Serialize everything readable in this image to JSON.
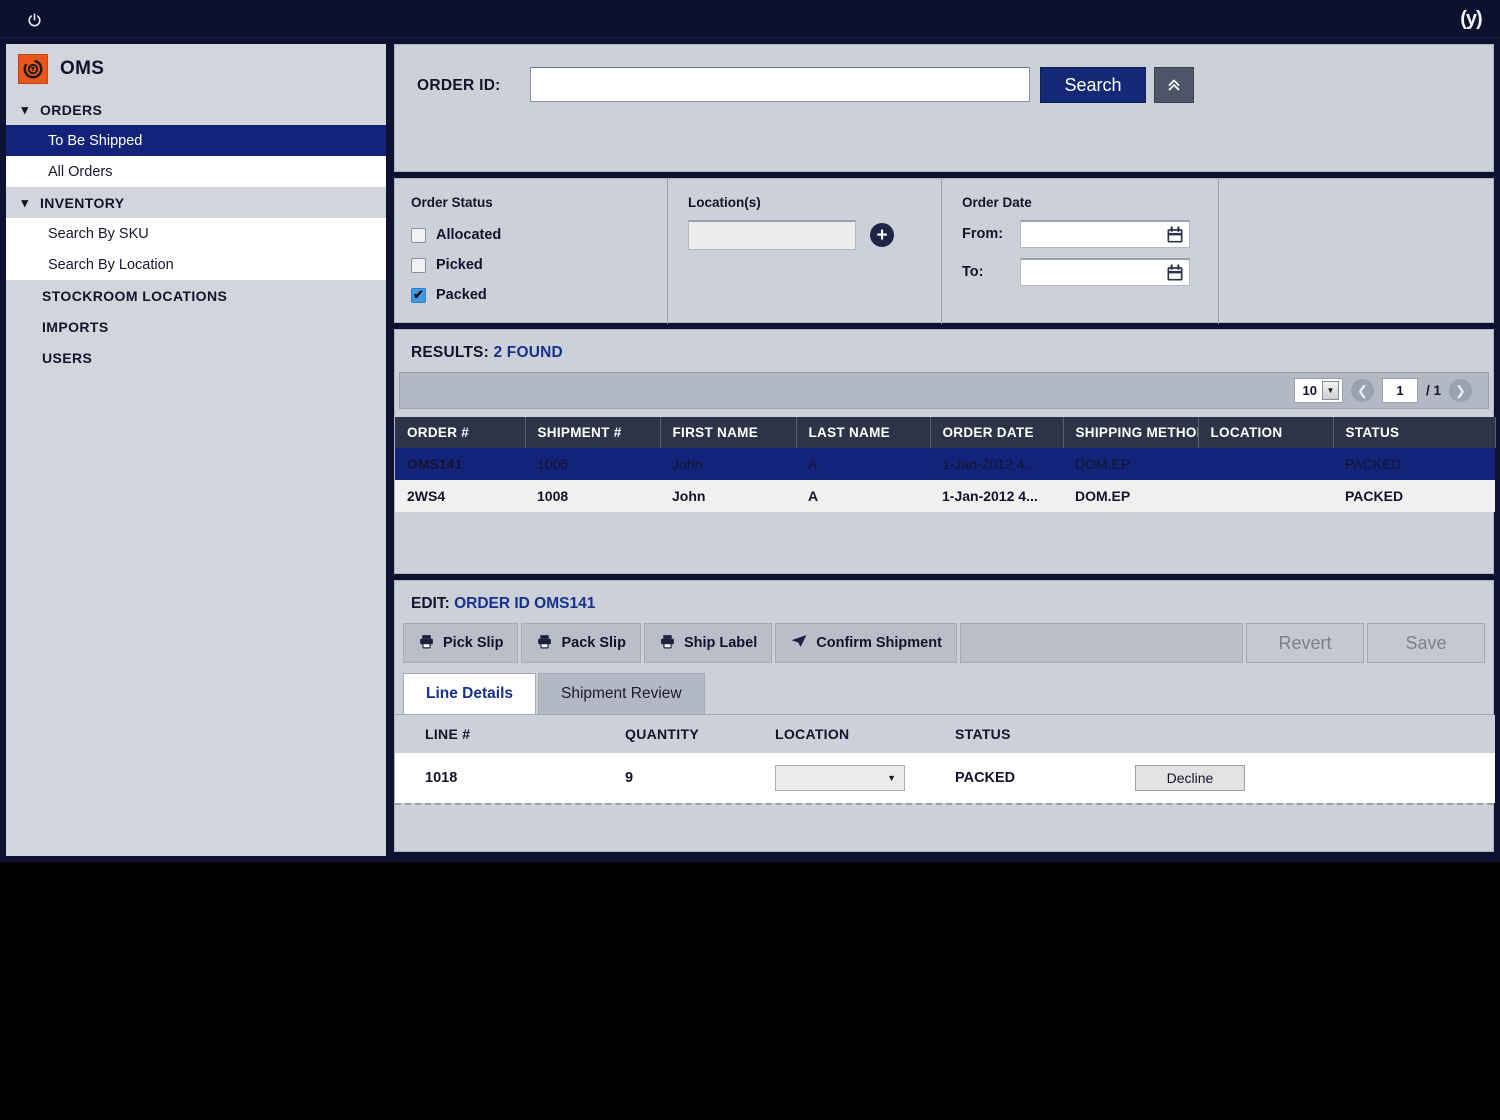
{
  "topbar": {
    "power_icon": "power-icon",
    "brand_glyph": "(y)"
  },
  "sidebar": {
    "logo_icon": "oms-logo-icon",
    "title": "OMS",
    "sections": [
      {
        "label": "ORDERS",
        "icon": "chevron-down-icon",
        "collapsible": true
      },
      {
        "label": "To Be Shipped",
        "type": "item",
        "active": true
      },
      {
        "label": "All Orders",
        "type": "item",
        "active": false
      },
      {
        "label": "INVENTORY",
        "icon": "chevron-down-icon",
        "collapsible": true
      },
      {
        "label": "Search By SKU",
        "type": "item",
        "active": false
      },
      {
        "label": "Search By Location",
        "type": "item",
        "active": false
      },
      {
        "label": "STOCKROOM LOCATIONS",
        "type": "section-plain"
      },
      {
        "label": "IMPORTS",
        "type": "section-plain"
      },
      {
        "label": "USERS",
        "type": "section-plain"
      }
    ]
  },
  "search": {
    "order_id_label": "ORDER ID:",
    "order_id_value": "",
    "order_id_placeholder": "",
    "search_label": "Search",
    "collapse_icon": "chevron-double-up-icon"
  },
  "filters": {
    "order_status": {
      "title": "Order Status",
      "options": [
        {
          "label": "Allocated",
          "checked": false
        },
        {
          "label": "Picked",
          "checked": false
        },
        {
          "label": "Packed",
          "checked": true
        }
      ]
    },
    "locations": {
      "title": "Location(s)",
      "value": "",
      "add_icon": "plus-circle-icon"
    },
    "order_date": {
      "title": "Order Date",
      "from_label": "From:",
      "from_value": "",
      "to_label": "To:",
      "to_value": "",
      "calendar_icon": "calendar-icon"
    }
  },
  "results": {
    "label": "RESULTS:",
    "count_text": "2 FOUND",
    "page_size": "10",
    "page_number": "1",
    "page_total": "/ 1",
    "prev_icon": "chevron-left-icon",
    "next_icon": "chevron-right-icon",
    "columns": [
      "ORDER #",
      "SHIPMENT #",
      "FIRST NAME",
      "LAST NAME",
      "ORDER DATE",
      "SHIPPING METHOD",
      "LOCATION",
      "STATUS"
    ],
    "rows": [
      {
        "order": "OMS141",
        "shipment": "1006",
        "first_name": "John",
        "last_name": "A",
        "order_date": "1-Jan-2012 4...",
        "shipping_method": "DOM.EP",
        "location": "",
        "status": "PACKED",
        "selected": true
      },
      {
        "order": "2WS4",
        "shipment": "1008",
        "first_name": "John",
        "last_name": "A",
        "order_date": "1-Jan-2012 4...",
        "shipping_method": "DOM.EP",
        "location": "",
        "status": "PACKED",
        "selected": false
      }
    ]
  },
  "edit": {
    "prefix": "EDIT: ",
    "heading": "ORDER ID OMS141",
    "toolbar": [
      {
        "label": "Pick Slip",
        "icon": "printer-icon",
        "disabled": false
      },
      {
        "label": "Pack Slip",
        "icon": "printer-icon",
        "disabled": false
      },
      {
        "label": "Ship Label",
        "icon": "printer-icon",
        "disabled": false
      },
      {
        "label": "Confirm Shipment",
        "icon": "paper-plane-icon",
        "disabled": false
      }
    ],
    "revert_label": "Revert",
    "save_label": "Save",
    "tabs": [
      {
        "label": "Line Details",
        "active": true
      },
      {
        "label": "Shipment Review",
        "active": false
      }
    ],
    "line_columns": [
      "LINE #",
      "QUANTITY",
      "LOCATION",
      "STATUS",
      ""
    ],
    "lines": [
      {
        "line": "1018",
        "quantity": "9",
        "location": "",
        "status": "PACKED",
        "action_label": "Decline"
      }
    ]
  },
  "colors": {
    "accent_navy": "#152a77",
    "selected_row": "#14237a",
    "link_blue": "#17318c",
    "logo_orange": "#e8551d",
    "header_slate": "#2e3447",
    "panel_gray": "#ccd0d8"
  }
}
